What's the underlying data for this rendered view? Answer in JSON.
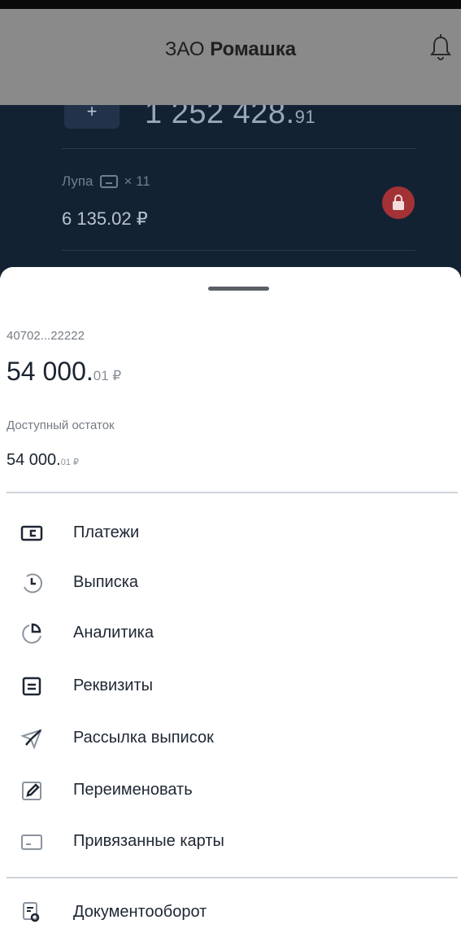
{
  "header": {
    "company_prefix": "ЗАО ",
    "company_name": "Ромашка"
  },
  "background_account": {
    "balance_main": "1 252 428.",
    "balance_kop": "91",
    "card_label": "Лупа",
    "card_count": "× 11",
    "card_amount": "6 135.02 ₽"
  },
  "sheet": {
    "account_number": "40702...22222",
    "balance_main": "54 000.",
    "balance_kop": "01 ₽",
    "available_label": "Доступный остаток",
    "available_main": "54 000.",
    "available_kop": "01 ₽"
  },
  "menu": [
    {
      "label": "Платежи",
      "icon": "payments-icon"
    },
    {
      "label": "Выписка",
      "icon": "statement-clock-icon"
    },
    {
      "label": "Аналитика",
      "icon": "analytics-pie-icon"
    },
    {
      "label": "Реквизиты",
      "icon": "requisites-list-icon"
    },
    {
      "label": "Рассылка выписок",
      "icon": "send-plane-icon"
    },
    {
      "label": "Переименовать",
      "icon": "pencil-icon"
    },
    {
      "label": "Привязанные карты",
      "icon": "card-icon"
    },
    {
      "label": "Документооборот",
      "icon": "document-search-icon"
    }
  ],
  "colors": {
    "app_background": "#132233",
    "overlay_header": "#8a8a8a",
    "lock_red": "#a33236",
    "icon_dark": "#1e2733"
  }
}
